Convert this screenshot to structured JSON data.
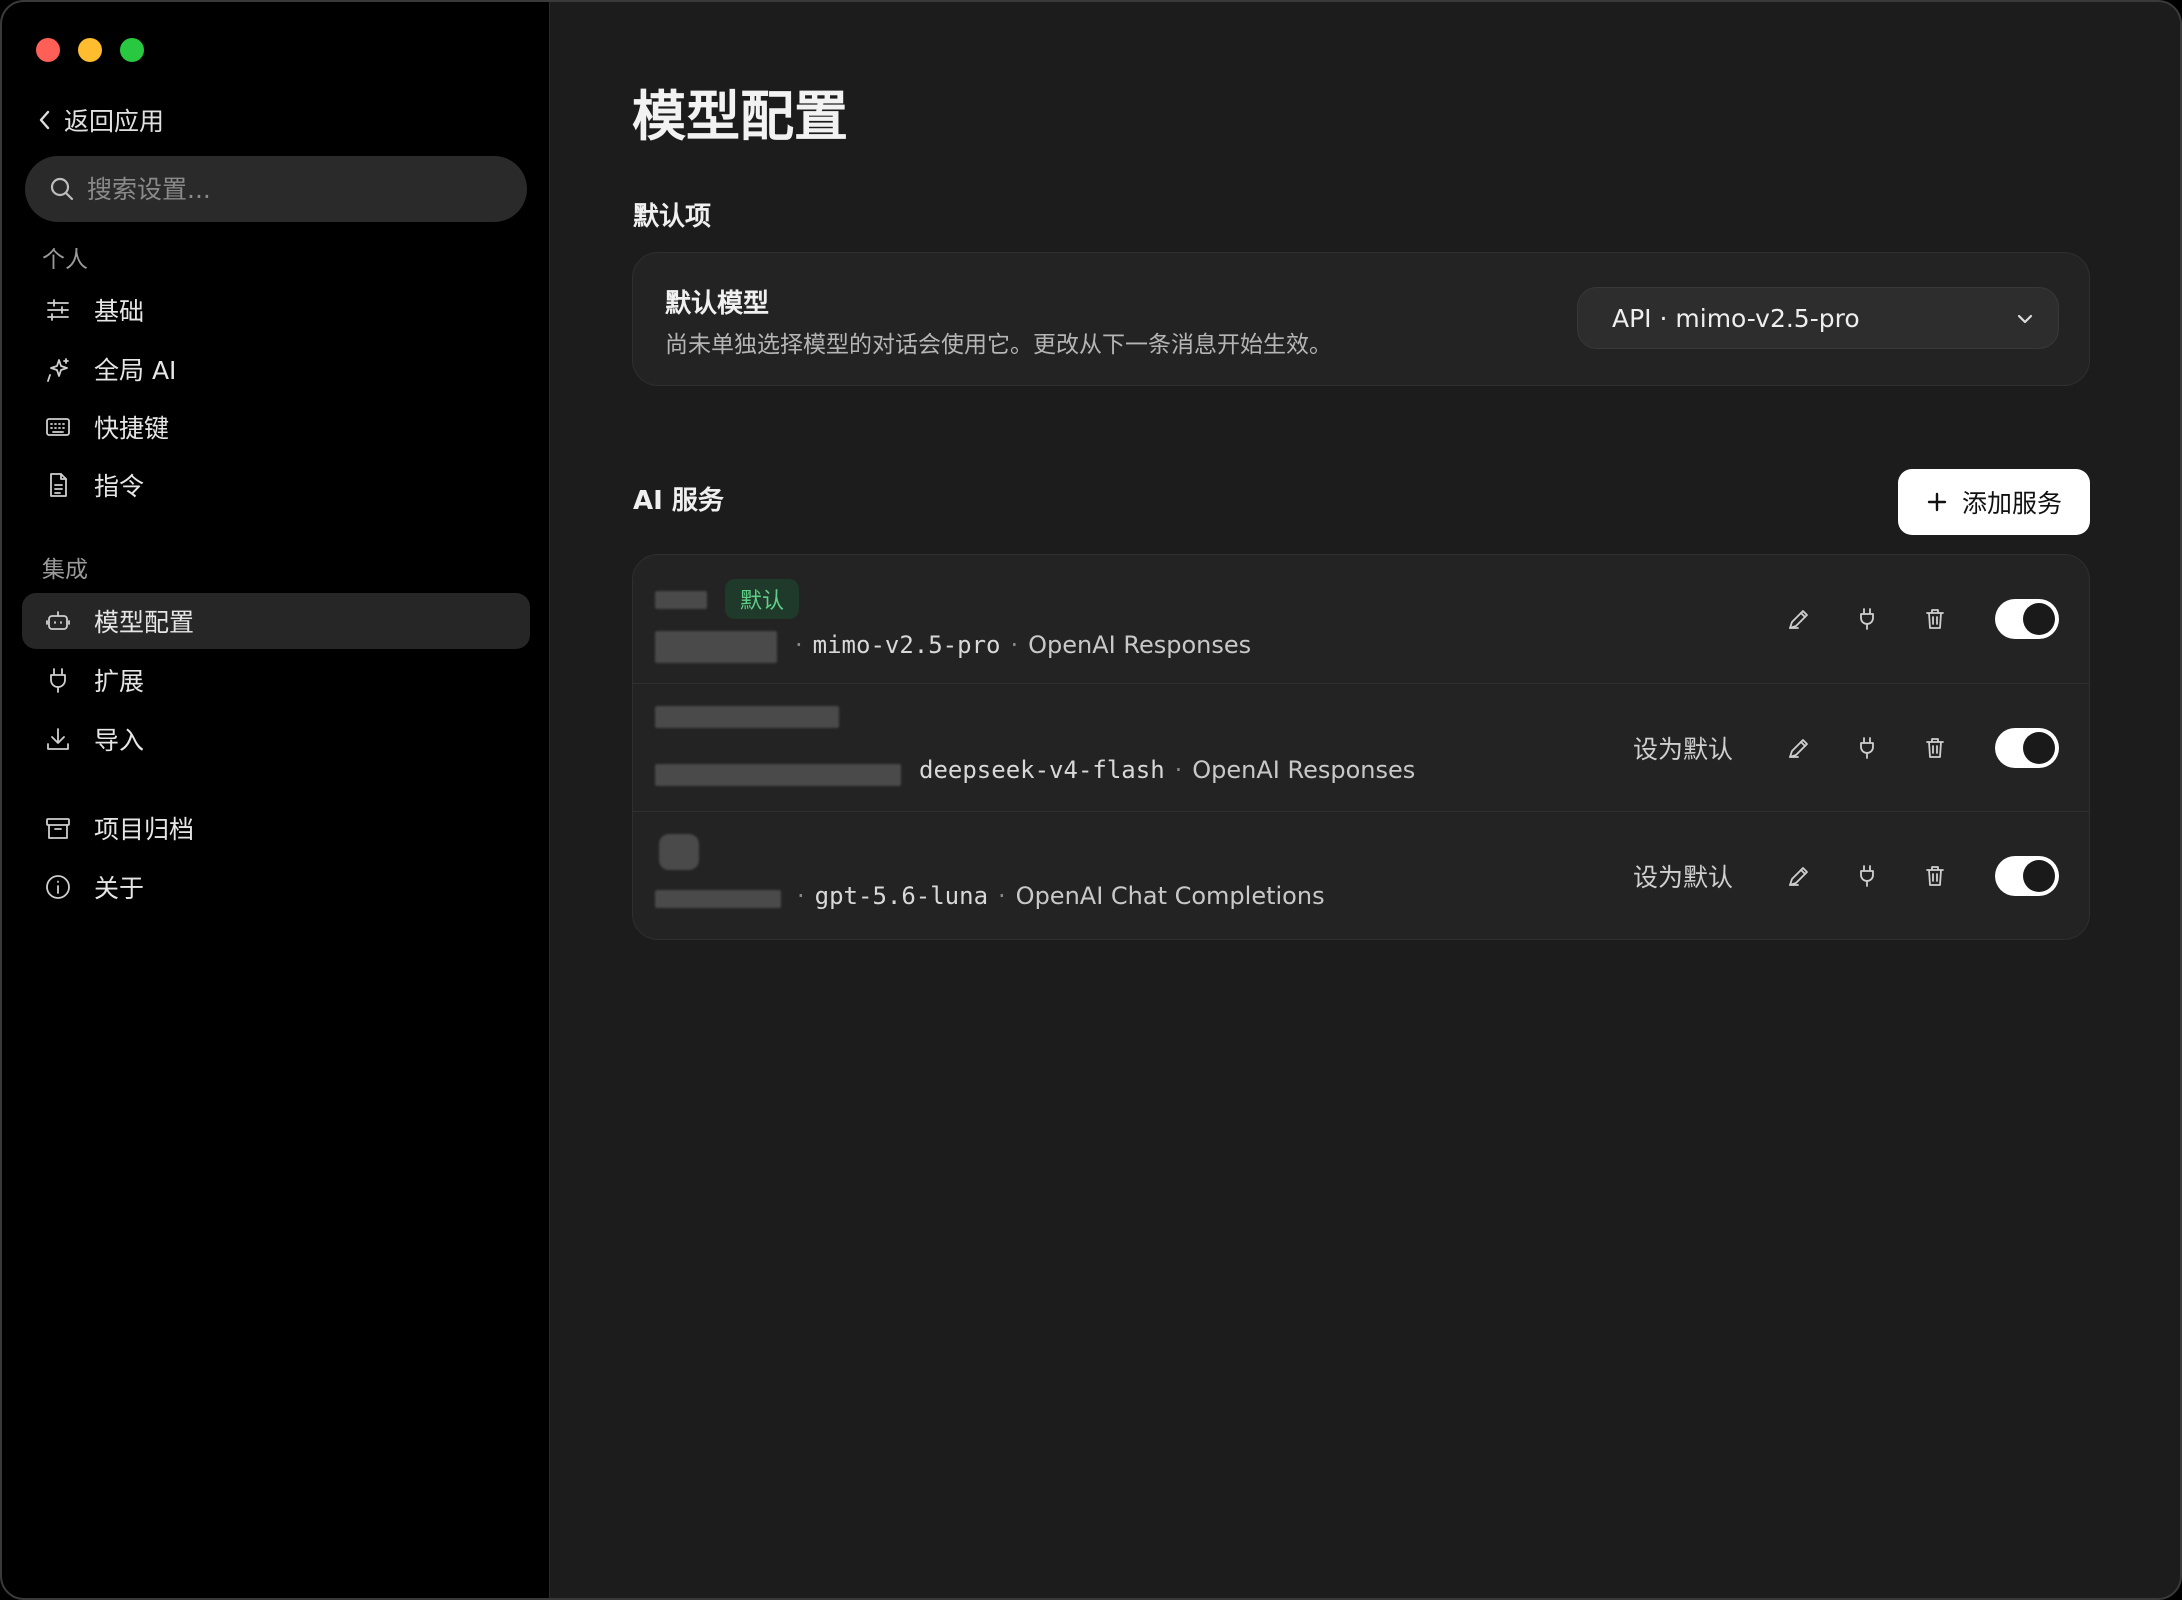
{
  "window": {
    "traffic_colors": [
      "#ff5f57",
      "#febc2e",
      "#28c840"
    ]
  },
  "sidebar": {
    "back_label": "返回应用",
    "search_placeholder": "搜索设置...",
    "sections": [
      {
        "label": "个人",
        "items": [
          {
            "label": "基础",
            "icon": "sliders-icon"
          },
          {
            "label": "全局 AI",
            "icon": "sparkle-icon"
          },
          {
            "label": "快捷键",
            "icon": "keyboard-icon"
          },
          {
            "label": "指令",
            "icon": "document-icon"
          }
        ]
      },
      {
        "label": "集成",
        "items": [
          {
            "label": "模型配置",
            "icon": "robot-icon",
            "active": true
          },
          {
            "label": "扩展",
            "icon": "plug-icon"
          },
          {
            "label": "导入",
            "icon": "download-icon"
          }
        ]
      },
      {
        "label": "",
        "items": [
          {
            "label": "项目归档",
            "icon": "archive-icon"
          },
          {
            "label": "关于",
            "icon": "info-icon"
          }
        ]
      }
    ]
  },
  "main": {
    "title": "模型配置",
    "defaults_heading": "默认项",
    "default_model": {
      "title": "默认模型",
      "description": "尚未单独选择模型的对话会使用它。更改从下一条消息开始生效。",
      "selected": "API · mimo-v2.5-pro"
    },
    "services_heading": "AI 服务",
    "add_service_label": "添加服务",
    "set_default_label": "设为默认",
    "services": [
      {
        "badge": "默认",
        "model": "mimo-v2.5-pro",
        "api": "OpenAI Responses",
        "enabled": true,
        "is_default": true
      },
      {
        "badge": "",
        "model": "deepseek-v4-flash",
        "api": "OpenAI Responses",
        "enabled": true,
        "is_default": false
      },
      {
        "badge": "",
        "model": "gpt-5.6-luna",
        "api": "OpenAI Chat Completions",
        "enabled": true,
        "is_default": false
      }
    ]
  }
}
